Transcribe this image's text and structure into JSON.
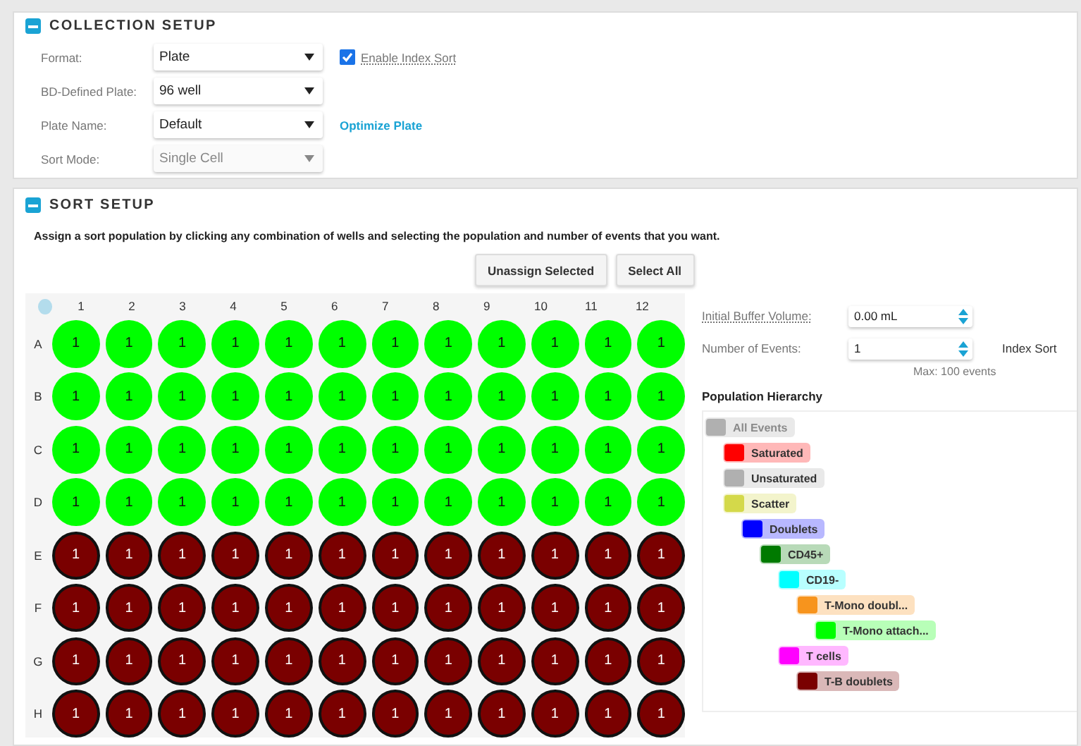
{
  "collection_setup": {
    "title": "COLLECTION SETUP",
    "expanded": true,
    "fields": [
      {
        "label": "Format:",
        "value": "Plate",
        "disabled": false
      },
      {
        "label": "BD-Defined Plate:",
        "value": "96 well",
        "disabled": false
      },
      {
        "label": "Plate Name:",
        "value": "Default",
        "disabled": false
      },
      {
        "label": "Sort Mode:",
        "value": "Single Cell",
        "disabled": true
      }
    ],
    "index_sort": {
      "label": "Enable Index Sort",
      "checked": true
    },
    "optimize_link": "Optimize Plate"
  },
  "sort_setup": {
    "title": "SORT SETUP",
    "expanded": true,
    "instructions": "Assign a sort population by clicking any combination of wells and selecting the population and number of events that you want.",
    "buttons": [
      "Unassign Selected",
      "Select All"
    ],
    "plate": {
      "columns": [
        "1",
        "2",
        "3",
        "4",
        "5",
        "6",
        "7",
        "8",
        "9",
        "10",
        "11",
        "12"
      ],
      "rows": [
        {
          "label": "A",
          "color": "#00ff00",
          "wells": [
            "1",
            "1",
            "1",
            "1",
            "1",
            "1",
            "1",
            "1",
            "1",
            "1",
            "1",
            "1"
          ]
        },
        {
          "label": "B",
          "color": "#00ff00",
          "wells": [
            "1",
            "1",
            "1",
            "1",
            "1",
            "1",
            "1",
            "1",
            "1",
            "1",
            "1",
            "1"
          ]
        },
        {
          "label": "C",
          "color": "#00ff00",
          "wells": [
            "1",
            "1",
            "1",
            "1",
            "1",
            "1",
            "1",
            "1",
            "1",
            "1",
            "1",
            "1"
          ]
        },
        {
          "label": "D",
          "color": "#00ff00",
          "wells": [
            "1",
            "1",
            "1",
            "1",
            "1",
            "1",
            "1",
            "1",
            "1",
            "1",
            "1",
            "1"
          ]
        },
        {
          "label": "E",
          "color": "#7a0000",
          "wells": [
            "1",
            "1",
            "1",
            "1",
            "1",
            "1",
            "1",
            "1",
            "1",
            "1",
            "1",
            "1"
          ]
        },
        {
          "label": "F",
          "color": "#7a0000",
          "wells": [
            "1",
            "1",
            "1",
            "1",
            "1",
            "1",
            "1",
            "1",
            "1",
            "1",
            "1",
            "1"
          ]
        },
        {
          "label": "G",
          "color": "#7a0000",
          "wells": [
            "1",
            "1",
            "1",
            "1",
            "1",
            "1",
            "1",
            "1",
            "1",
            "1",
            "1",
            "1"
          ]
        },
        {
          "label": "H",
          "color": "#7a0000",
          "wells": [
            "1",
            "1",
            "1",
            "1",
            "1",
            "1",
            "1",
            "1",
            "1",
            "1",
            "1",
            "1"
          ]
        }
      ]
    },
    "buffer_volume": {
      "label": "Initial Buffer Volume:",
      "value": "0.00 mL"
    },
    "events": {
      "label": "Number of Events:",
      "value": "1",
      "note": "Max: 100 events"
    },
    "index_sort_label": "Index Sort",
    "hierarchy_title": "Population Hierarchy",
    "hierarchy": [
      {
        "name": "All Events",
        "color": "#b0b0b0",
        "disabled": true,
        "children": [
          {
            "name": "Saturated",
            "color": "#ff0000",
            "disabled": false
          },
          {
            "name": "Unsaturated",
            "color": "#b0b0b0",
            "disabled": false
          },
          {
            "name": "Scatter",
            "color": "#d4d94a",
            "disabled": false,
            "children": [
              {
                "name": "Doublets",
                "color": "#0000ff",
                "disabled": false,
                "children": [
                  {
                    "name": "CD45+",
                    "color": "#007a00",
                    "disabled": false,
                    "children": [
                      {
                        "name": "CD19-",
                        "color": "#00ffff",
                        "disabled": false,
                        "children": [
                          {
                            "name": "T-Mono doubl...",
                            "color": "#f7941d",
                            "disabled": false,
                            "children": [
                              {
                                "name": "T-Mono attach...",
                                "color": "#00ff00",
                                "disabled": false
                              }
                            ]
                          }
                        ]
                      },
                      {
                        "name": "T cells",
                        "color": "#ff00ff",
                        "disabled": false,
                        "children": [
                          {
                            "name": "T-B doublets",
                            "color": "#7a0000",
                            "disabled": false
                          }
                        ]
                      }
                    ]
                  }
                ]
              }
            ]
          }
        ]
      }
    ]
  }
}
